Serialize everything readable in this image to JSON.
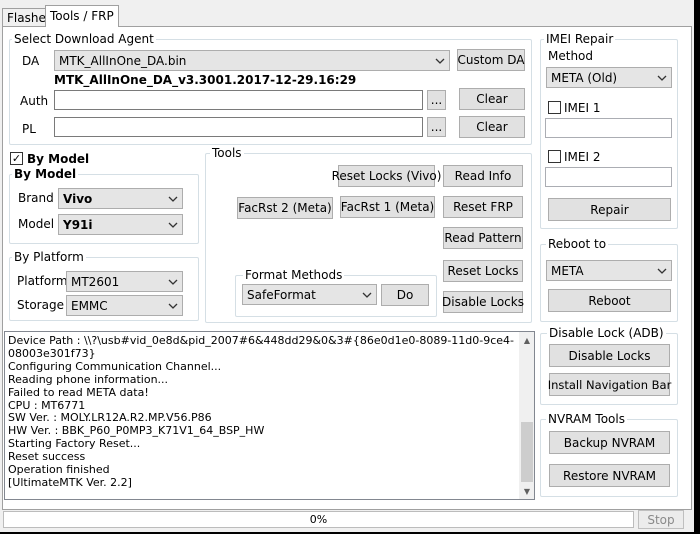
{
  "tabs": [
    "Flasher",
    "Tools / FRP"
  ],
  "download_agent": {
    "title": "Select Download Agent",
    "da_label": "DA",
    "da_value": "MTK_AllInOne_DA.bin",
    "da_version": "MTK_AllInOne_DA_v3.3001.2017-12-29.16:29",
    "custom_da": "Custom DA",
    "auth_label": "Auth",
    "auth_value": "",
    "pl_label": "PL",
    "pl_value": "",
    "browse": "...",
    "clear": "Clear"
  },
  "by_model": {
    "checkbox_label": "By Model",
    "checked": true,
    "group_title": "By Model",
    "brand_label": "Brand",
    "brand_value": "Vivo",
    "model_label": "Model",
    "model_value": "Y91i"
  },
  "by_platform": {
    "title": "By Platform",
    "platform_label": "Platform",
    "platform_value": "MT2601",
    "storage_label": "Storage",
    "storage_value": "EMMC"
  },
  "tools": {
    "title": "Tools",
    "reset_locks_vivo": "Reset Locks (Vivo)",
    "read_info": "Read Info",
    "facrst2": "FacRst 2 (Meta)",
    "facrst1": "FacRst 1 (Meta)",
    "reset_frp": "Reset FRP",
    "read_pattern": "Read Pattern",
    "reset_locks": "Reset Locks",
    "disable_locks": "Disable Locks",
    "format_title": "Format Methods",
    "format_value": "SafeFormat",
    "do": "Do"
  },
  "imei": {
    "title": "IMEI Repair",
    "method_label": "Method",
    "method_value": "META (Old)",
    "imei1_label": "IMEI 1",
    "imei1_value": "",
    "imei2_label": "IMEI 2",
    "imei2_value": "",
    "repair": "Repair"
  },
  "reboot": {
    "title": "Reboot to",
    "value": "META",
    "button": "Reboot"
  },
  "adb": {
    "title": "Disable Lock (ADB)",
    "disable_locks": "Disable Locks",
    "install_nav": "Install Navigation Bar"
  },
  "nvram": {
    "title": "NVRAM Tools",
    "backup": "Backup NVRAM",
    "restore": "Restore NVRAM"
  },
  "log_lines": [
    "Device Path : \\\\?\\usb#vid_0e8d&pid_2007#6&448dd29&0&3#{86e0d1e0-8089-11d0-9ce4-",
    "08003e301f73}",
    "Configuring Communication Channel...",
    "Reading phone information...",
    "Failed to read META data!",
    "CPU : MT6771",
    "SW Ver. : MOLY.LR12A.R2.MP.V56.P86",
    "HW Ver. : BBK_P60_P0MP3_K71V1_64_BSP_HW",
    "Starting Factory Reset...",
    "Reset success",
    "Operation finished",
    "[UltimateMTK Ver. 2.2]"
  ],
  "progress": {
    "text": "0%",
    "value": 0
  },
  "stop": "Stop",
  "icons": {
    "dropdown": "chevron-down-icon",
    "check": "checkmark-icon"
  }
}
